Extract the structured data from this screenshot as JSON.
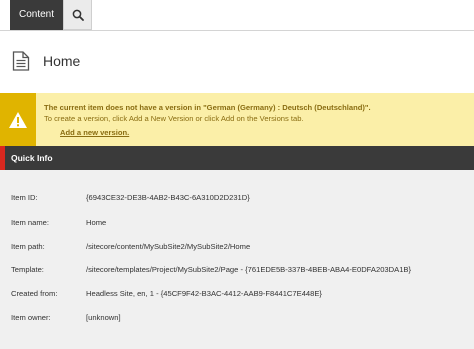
{
  "tabs": {
    "content_label": "Content",
    "search_icon": "search-icon"
  },
  "header": {
    "icon": "document-icon",
    "title": "Home"
  },
  "warning": {
    "icon": "warning-icon",
    "title": "The current item does not have a version in \"German (Germany) : Deutsch (Deutschland)\".",
    "text": "To create a version, click Add a New Version or click Add on the Versions tab.",
    "link": "Add a new version."
  },
  "quick_info": {
    "title": "Quick Info",
    "rows": [
      {
        "label": "Item ID:",
        "value": "{6943CE32-DE3B-4AB2-B43C-6A310D2D231D}"
      },
      {
        "label": "Item name:",
        "value": "Home"
      },
      {
        "label": "Item path:",
        "value": "/sitecore/content/MySubSite2/MySubSite2/Home"
      },
      {
        "label": "Template:",
        "value": "/sitecore/templates/Project/MySubSite2/Page - {761EDE5B-337B-4BEB-ABA4-E0DFA203DA1B}"
      },
      {
        "label": "Created from:",
        "value": "Headless Site, en, 1 - {45CF9F42-B3AC-4412-AAB9-F8441C7E448E}"
      },
      {
        "label": "Item owner:",
        "value": "[unknown]"
      }
    ]
  }
}
